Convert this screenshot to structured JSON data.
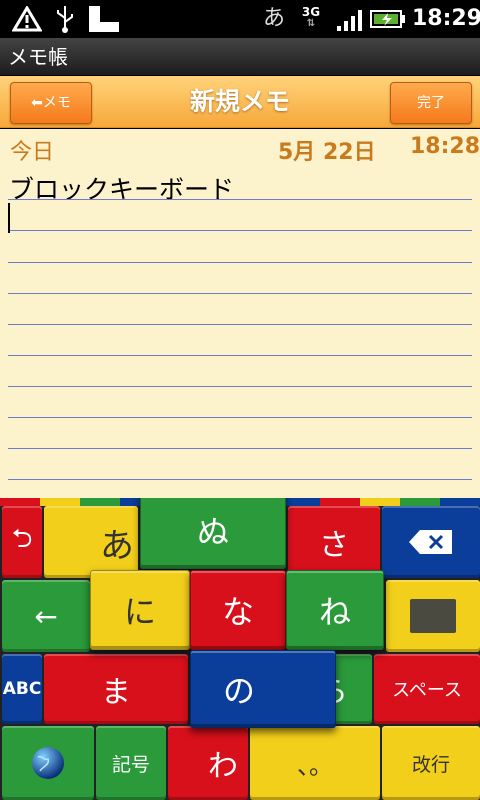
{
  "status_bar": {
    "ime_indicator": "あ",
    "network": "3G",
    "time": "18:29",
    "icons": [
      "warning-icon",
      "usb-icon",
      "sd-card-icon",
      "ime-icon",
      "network-3g-icon",
      "signal-icon",
      "battery-charging-icon"
    ]
  },
  "app": {
    "title": "メモ帳"
  },
  "header": {
    "back_label": "メモ",
    "title": "新規メモ",
    "done_label": "完了"
  },
  "memo": {
    "today_label": "今日",
    "date": "5月 22日",
    "time": "18:28",
    "text": "ブロックキーボード"
  },
  "keyboard": {
    "undo": "⮌",
    "a": "あ",
    "nu": "ぬ",
    "sa": "さ",
    "backspace": "⌫",
    "left": "←",
    "ni": "に",
    "na": "な",
    "ne": "ね",
    "abc": "ABC",
    "ma": "ま",
    "no": "の",
    "ra": "ら",
    "space": "スペース",
    "symbol": "記号",
    "wa": "わ",
    "punct": "、。",
    "enter": "改行"
  },
  "colors": {
    "red": "#d8101c",
    "green": "#2a9a3a",
    "yellow": "#f2cf1a",
    "blue": "#0a3e9a",
    "header_orange": "#f7a83a",
    "paper": "#fcf2cc"
  }
}
